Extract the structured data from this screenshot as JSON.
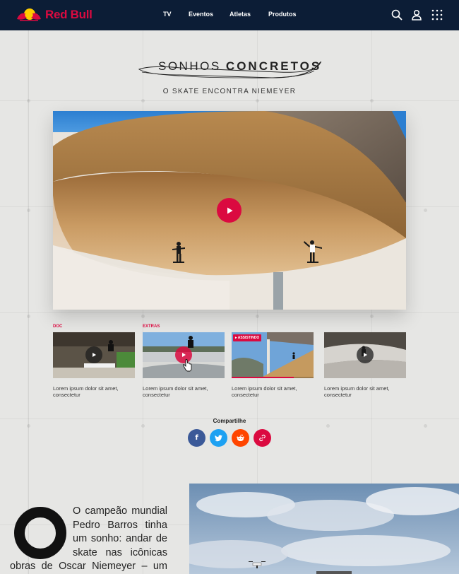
{
  "header": {
    "brand": "Red Bull",
    "nav": [
      {
        "label": "TV"
      },
      {
        "label": "Eventos"
      },
      {
        "label": "Atletas"
      },
      {
        "label": "Produtos"
      }
    ],
    "icons": [
      "search-icon",
      "user-icon",
      "apps-grid-icon"
    ]
  },
  "hero": {
    "title_light": "SONHOS",
    "title_bold": "CONCRETOS",
    "subtitle": "O SKATE ENCONTRA NIEMEYER"
  },
  "thumbnails": [
    {
      "label": "DOC",
      "caption_line1": "Lorem ipsum dolor sit amet,",
      "caption_line2": "consectetur"
    },
    {
      "label": "EXTRAS",
      "caption_line1": "Lorem ipsum dolor sit amet,",
      "caption_line2": "consectetur"
    },
    {
      "label": "",
      "badge": "▸ ASSISTINDO",
      "caption_line1": "Lorem ipsum dolor sit amet,",
      "caption_line2": "consectetur",
      "progress": 0.76
    },
    {
      "label": "",
      "caption_line1": "Lorem ipsum dolor sit amet,",
      "caption_line2": "consectetur"
    }
  ],
  "share": {
    "title": "Compartilhe",
    "buttons": [
      {
        "name": "facebook",
        "glyph": "f",
        "color": "#3b5998"
      },
      {
        "name": "twitter",
        "glyph": "🐦",
        "color": "#1da1f2"
      },
      {
        "name": "reddit",
        "glyph": "👽",
        "color": "#ff4500"
      },
      {
        "name": "link",
        "glyph": "🔗",
        "color": "#db0a40"
      }
    ]
  },
  "article": {
    "lines": [
      "O campeão mundial",
      "Pedro Barros tinha",
      "um sonho: andar de",
      "skate nas icônicas",
      "obras de Oscar Niemeyer – um"
    ],
    "dropcap": "O"
  },
  "colors": {
    "brand_red": "#db0a40",
    "header_bg": "#0c1d36"
  }
}
